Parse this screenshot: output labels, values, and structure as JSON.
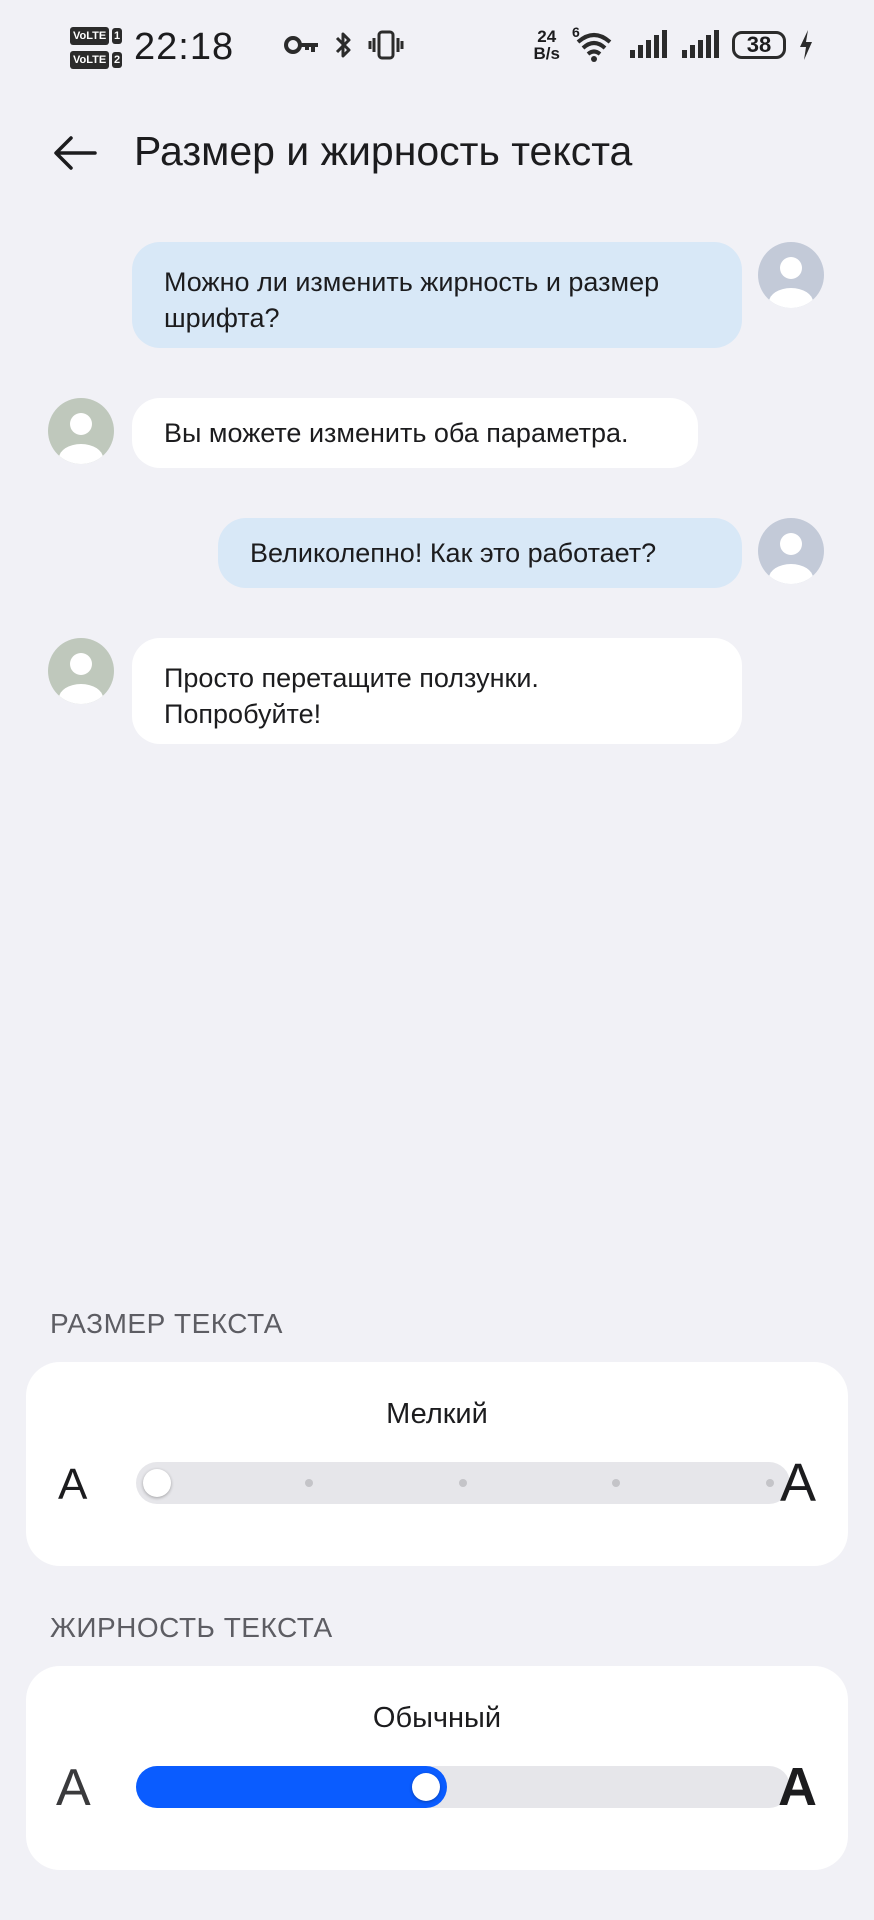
{
  "status_bar": {
    "volte1": "VoLTE",
    "sim1": "1",
    "volte2": "VoLTE",
    "sim2": "2",
    "time": "22:18",
    "net_speed_value": "24",
    "net_speed_unit": "B/s",
    "wifi_gen": "6",
    "battery": "38"
  },
  "header": {
    "title": "Размер и жирность текста"
  },
  "chat": {
    "messages": [
      {
        "from": "user",
        "text": "Можно ли изменить жирность и размер шрифта?"
      },
      {
        "from": "bot",
        "text": "Вы можете изменить оба параметра."
      },
      {
        "from": "user",
        "text": "Великолепно! Как это работает?"
      },
      {
        "from": "bot",
        "text": "Просто перетащите ползунки. Попробуйте!"
      }
    ]
  },
  "text_size": {
    "label": "РАЗМЕР ТЕКСТА",
    "value": "Мелкий",
    "min_glyph": "A",
    "max_glyph": "A",
    "level": 0,
    "steps": 5
  },
  "text_weight": {
    "label": "ЖИРНОСТЬ ТЕКСТА",
    "value": "Обычный",
    "min_glyph": "A",
    "max_glyph": "A",
    "fraction": 0.44
  },
  "colors": {
    "accent": "#0a5cff",
    "user_bubble": "#d8e8f7",
    "bot_bubble": "#ffffff",
    "background": "#f1f1f6"
  }
}
